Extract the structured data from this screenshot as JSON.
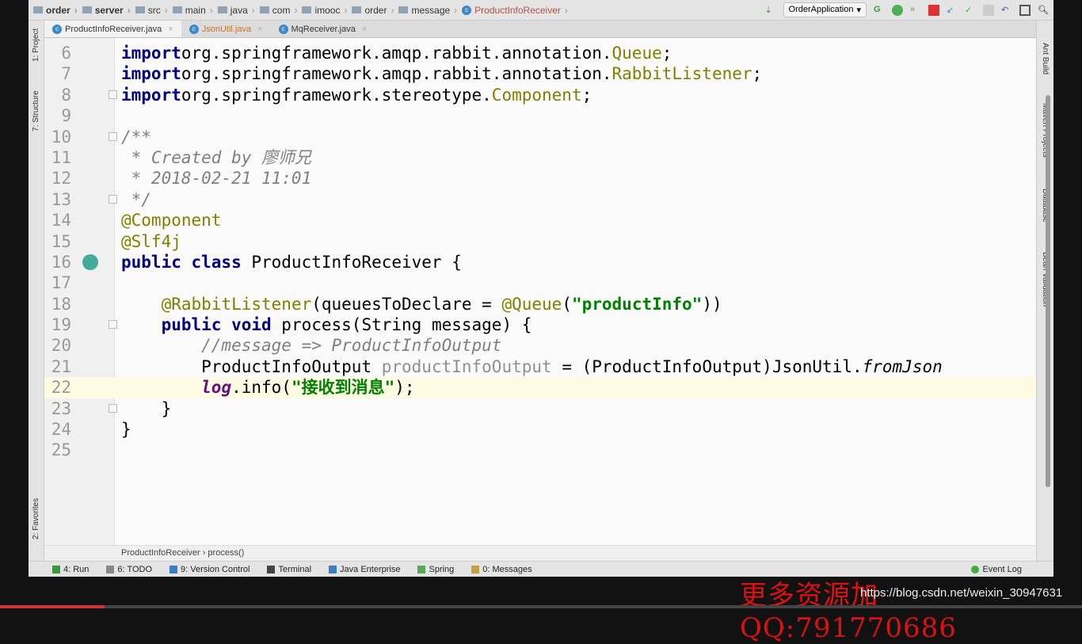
{
  "breadcrumb": [
    "order",
    "server",
    "src",
    "main",
    "java",
    "com",
    "imooc",
    "order",
    "message",
    "ProductInfoReceiver"
  ],
  "run_config": "OrderApplication",
  "tabs": [
    {
      "label": "ProductInfoReceiver.java",
      "active": true
    },
    {
      "label": "JsonUtil.java"
    },
    {
      "label": "MqReceiver.java"
    }
  ],
  "left_tools": [
    "1: Project",
    "7: Structure",
    "2: Favorites"
  ],
  "right_tools": [
    "Ant Build",
    "Maven Projects",
    "Database",
    "Bean Validation"
  ],
  "code": [
    {
      "n": "6",
      "t": [
        [
          "kw",
          "import"
        ],
        [
          "",
          "org.springframework.amqp.rabbit.annotation."
        ],
        [
          "cls",
          "Queue"
        ],
        [
          "",
          ";"
        ]
      ]
    },
    {
      "n": "7",
      "t": [
        [
          "kw",
          "import"
        ],
        [
          "",
          "org.springframework.amqp.rabbit.annotation."
        ],
        [
          "cls",
          "RabbitListener"
        ],
        [
          "",
          ";"
        ]
      ]
    },
    {
      "n": "8",
      "t": [
        [
          "kw",
          "import"
        ],
        [
          "",
          "org.springframework.stereotype."
        ],
        [
          "cls",
          "Component"
        ],
        [
          "",
          ";"
        ]
      ]
    },
    {
      "n": "9",
      "t": []
    },
    {
      "n": "10",
      "t": [
        [
          "cm",
          "/**"
        ]
      ]
    },
    {
      "n": "11",
      "t": [
        [
          "cm",
          " * Created by 廖师兄"
        ]
      ]
    },
    {
      "n": "12",
      "t": [
        [
          "cm",
          " * 2018-02-21 11:01"
        ]
      ]
    },
    {
      "n": "13",
      "t": [
        [
          "cm",
          " */"
        ]
      ]
    },
    {
      "n": "14",
      "t": [
        [
          "ann",
          "@Component"
        ]
      ]
    },
    {
      "n": "15",
      "t": [
        [
          "ann",
          "@Slf4j"
        ]
      ]
    },
    {
      "n": "16",
      "t": [
        [
          "kw",
          "public class"
        ],
        [
          "",
          " ProductInfoReceiver {"
        ]
      ]
    },
    {
      "n": "17",
      "t": []
    },
    {
      "n": "18",
      "t": [
        [
          "",
          "    "
        ],
        [
          "ann",
          "@RabbitListener"
        ],
        [
          "",
          "(queuesToDeclare = "
        ],
        [
          "ann",
          "@Queue"
        ],
        [
          "",
          "("
        ],
        [
          "str",
          "\"productInfo\""
        ],
        [
          "",
          "))"
        ]
      ]
    },
    {
      "n": "19",
      "t": [
        [
          "",
          "    "
        ],
        [
          "kw",
          "public void"
        ],
        [
          "",
          " process(String message) {"
        ]
      ]
    },
    {
      "n": "20",
      "t": [
        [
          "cm",
          "        //message => ProductInfoOutput"
        ]
      ]
    },
    {
      "n": "21",
      "t": [
        [
          "",
          "        ProductInfoOutput "
        ],
        [
          "var",
          "productInfoOutput"
        ],
        [
          "",
          " = (ProductInfoOutput)JsonUtil."
        ],
        [
          "st",
          "fromJson"
        ]
      ]
    },
    {
      "n": "22",
      "t": [
        [
          "",
          "        "
        ],
        [
          "lg",
          "log"
        ],
        [
          "",
          ".info("
        ],
        [
          "str",
          "\"接收到消息\""
        ],
        [
          "",
          ");"
        ]
      ],
      "current": true
    },
    {
      "n": "23",
      "t": [
        [
          "",
          "    }"
        ]
      ]
    },
    {
      "n": "24",
      "t": [
        [
          "",
          "}"
        ]
      ]
    },
    {
      "n": "25",
      "t": []
    }
  ],
  "footer_crumbs": "ProductInfoReceiver  ›  process()",
  "bottom_tools": [
    "4: Run",
    "6: TODO",
    "9: Version Control",
    "Terminal",
    "Java Enterprise",
    "Spring",
    "0: Messages"
  ],
  "event_log": "Event Log",
  "watermark": "更多资源加QQ:791770686",
  "watermark_url": "https://blog.csdn.net/weixin_30947631",
  "colors": {
    "keyword": "#000080",
    "annotation": "#808000",
    "string": "#008000",
    "comment": "#808080"
  }
}
